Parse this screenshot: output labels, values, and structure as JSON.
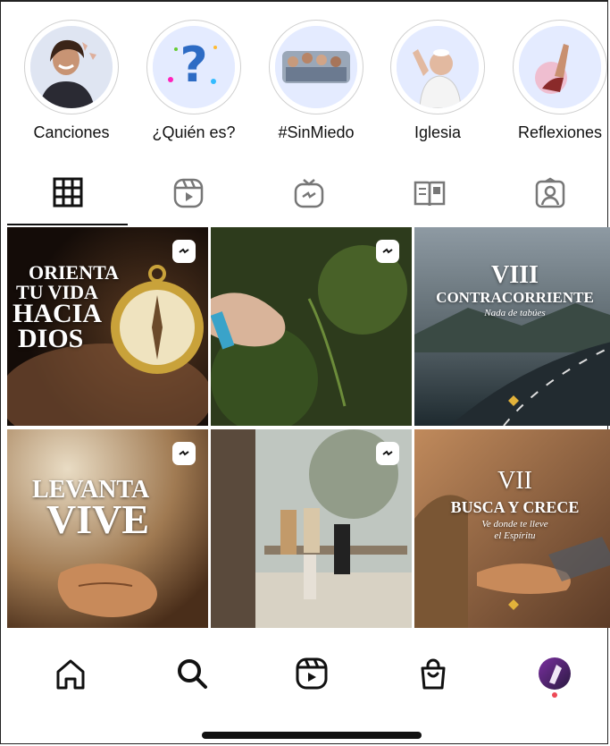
{
  "highlights": [
    {
      "label": "Canciones",
      "icon": "singer-photo"
    },
    {
      "label": "¿Quién es?",
      "icon": "question-mark"
    },
    {
      "label": "#SinMiedo",
      "icon": "crowd-photo"
    },
    {
      "label": "Iglesia",
      "icon": "pope-photo"
    },
    {
      "label": "Reflexiones",
      "icon": "raised-hand-photo"
    }
  ],
  "tabs": [
    {
      "name": "posts-grid",
      "icon": "grid-icon",
      "active": true
    },
    {
      "name": "reels",
      "icon": "reels-icon",
      "active": false
    },
    {
      "name": "igtv",
      "icon": "igtv-icon",
      "active": false
    },
    {
      "name": "guides",
      "icon": "guide-icon",
      "active": false
    },
    {
      "name": "tagged",
      "icon": "tagged-icon",
      "active": false
    }
  ],
  "posts": [
    {
      "lines": [
        "ORIENTA",
        "TU VIDA",
        "HACIA",
        "DIOS"
      ],
      "igtv": true
    },
    {
      "lines": [],
      "igtv": true
    },
    {
      "number": "VIII",
      "title": "CONTRACORRIENTE",
      "subtitle": "Nada de tabúes",
      "igtv": false
    },
    {
      "lines": [
        "LEVANTA",
        "VIVE"
      ],
      "igtv": true
    },
    {
      "lines": [],
      "igtv": true
    },
    {
      "number": "VII",
      "title": "BUSCA Y CRECE",
      "subtitle": "Ve donde te lleve",
      "subtitle2": "el Espíritu",
      "igtv": false
    }
  ],
  "bottom_nav": [
    "home-icon",
    "search-icon",
    "reels-icon",
    "shop-icon",
    "profile-avatar"
  ],
  "colors": {
    "accent": "#ed4956",
    "highlight_bg": "#e4ebff"
  }
}
